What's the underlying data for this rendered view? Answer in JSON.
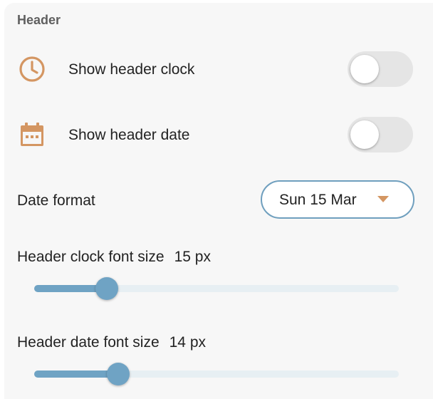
{
  "section": {
    "title": "Header"
  },
  "settings": {
    "clock": {
      "label": "Show header clock",
      "icon": "clock-icon",
      "enabled": false
    },
    "date": {
      "label": "Show header date",
      "icon": "calendar-icon",
      "enabled": false
    },
    "date_format": {
      "label": "Date format",
      "selected": "Sun 15 Mar"
    },
    "clock_font_size": {
      "label": "Header clock font size",
      "value_text": "15 px",
      "fraction": 0.2
    },
    "date_font_size": {
      "label": "Header date font size",
      "value_text": "14 px",
      "fraction": 0.23
    }
  },
  "colors": {
    "icon": "#d49662",
    "accent": "#6fa3c4",
    "toggle_off": "#e5e5e5",
    "panel_bg": "#f7f7f7"
  }
}
